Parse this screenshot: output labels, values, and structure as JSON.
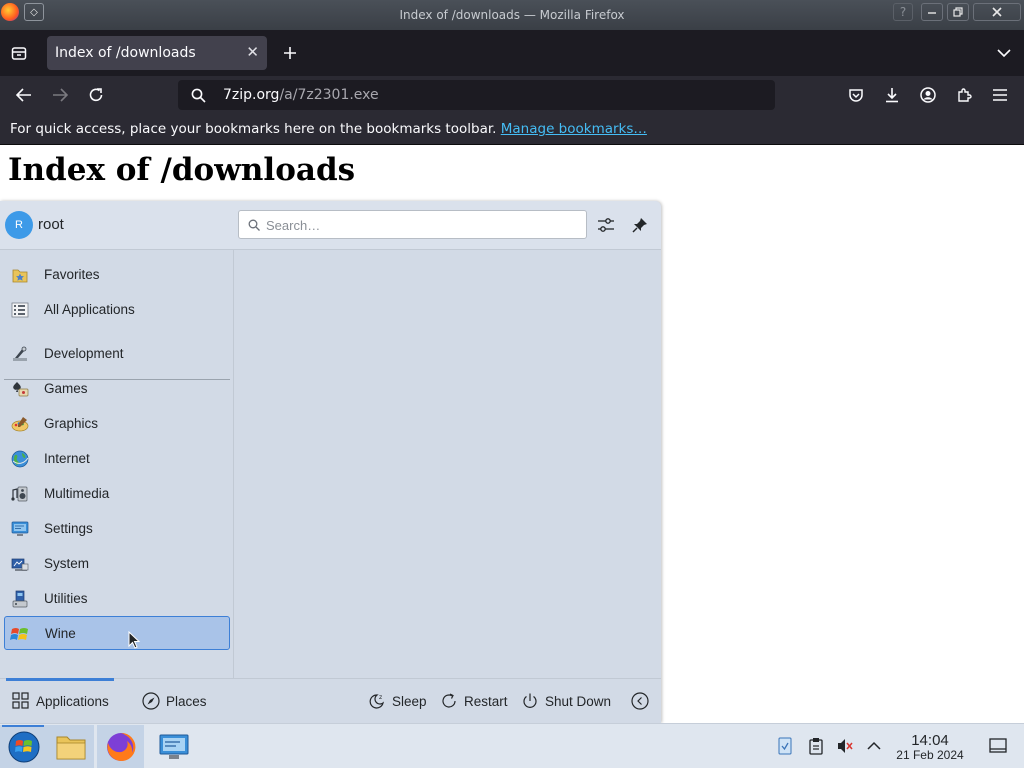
{
  "window": {
    "title": "Index of /downloads — Mozilla Firefox"
  },
  "tabs": [
    {
      "label": "Index of /downloads"
    }
  ],
  "urlbar": {
    "host": "7zip.org",
    "path": "/a/7z2301.exe"
  },
  "bookmarks_bar": {
    "message": "For quick access, place your bookmarks here on the bookmarks toolbar.",
    "link": "Manage bookmarks…"
  },
  "page": {
    "heading": "Index of /downloads"
  },
  "launcher": {
    "user": {
      "avatar_letter": "R",
      "name": "root"
    },
    "search": {
      "placeholder": "Search…"
    },
    "categories_top": [
      {
        "label": "Favorites",
        "icon": "favorites-icon"
      },
      {
        "label": "All Applications",
        "icon": "all-applications-icon"
      }
    ],
    "categories": [
      {
        "label": "Development",
        "icon": "development-icon"
      },
      {
        "label": "Games",
        "icon": "games-icon"
      },
      {
        "label": "Graphics",
        "icon": "graphics-icon"
      },
      {
        "label": "Internet",
        "icon": "internet-icon"
      },
      {
        "label": "Multimedia",
        "icon": "multimedia-icon"
      },
      {
        "label": "Settings",
        "icon": "settings-icon"
      },
      {
        "label": "System",
        "icon": "system-icon"
      },
      {
        "label": "Utilities",
        "icon": "utilities-icon"
      },
      {
        "label": "Wine",
        "icon": "wine-icon",
        "selected": true
      }
    ],
    "footer": {
      "applications": "Applications",
      "places": "Places",
      "sleep": "Sleep",
      "restart": "Restart",
      "shutdown": "Shut Down"
    }
  },
  "taskbar": {
    "apps": [
      "start-menu",
      "file-manager",
      "firefox",
      "system-settings"
    ],
    "clock": {
      "time": "14:04",
      "date": "21 Feb 2024"
    }
  },
  "colors": {
    "accent": "#3d7fd6",
    "launcher_bg": "#d2dae6",
    "selected_bg": "#a9c3e8",
    "firefox_toolbar": "#2b2a33",
    "link": "#45bdf5"
  }
}
